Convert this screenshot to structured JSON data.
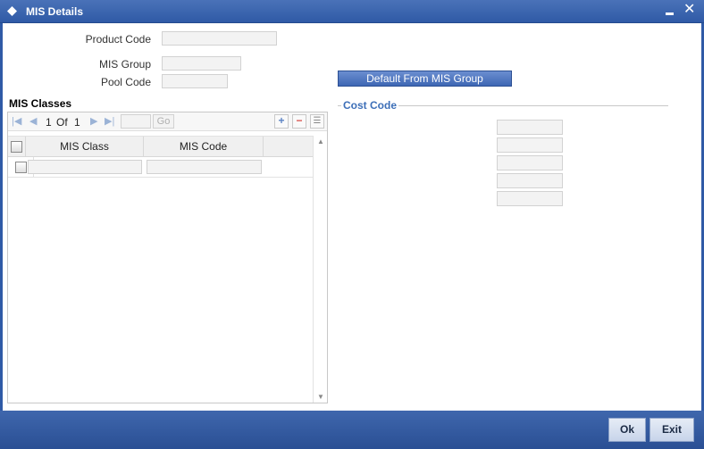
{
  "window": {
    "title": "MIS Details",
    "minimize_label": "▬",
    "close_label": "✕"
  },
  "header_form": {
    "product_code_label": "Product Code",
    "product_code_value": "",
    "mis_group_label": "MIS Group",
    "mis_group_value": "",
    "pool_code_label": "Pool Code",
    "pool_code_value": "",
    "default_button_label": "Default From MIS Group"
  },
  "mis_classes": {
    "title": "MIS Classes",
    "pager": {
      "current": "1",
      "of_label": "Of",
      "total": "1",
      "page_input": "",
      "go_label": "Go"
    },
    "columns": [
      "MIS Class",
      "MIS Code"
    ],
    "rows": [
      {
        "mis_class": "",
        "mis_code": ""
      }
    ]
  },
  "cost_code": {
    "title": "Cost Code",
    "fields": [
      "",
      "",
      "",
      "",
      ""
    ]
  },
  "footer": {
    "ok_label": "Ok",
    "exit_label": "Exit"
  },
  "colors": {
    "titlebar": "#2f5aa6",
    "accent_text": "#3d6fb8",
    "button_blue": "#3e67b4"
  },
  "icons": [
    "diamond-icon",
    "minimize-icon",
    "close-icon",
    "first-page-icon",
    "prev-page-icon",
    "next-page-icon",
    "last-page-icon",
    "add-row-icon",
    "delete-row-icon",
    "single-view-icon"
  ]
}
